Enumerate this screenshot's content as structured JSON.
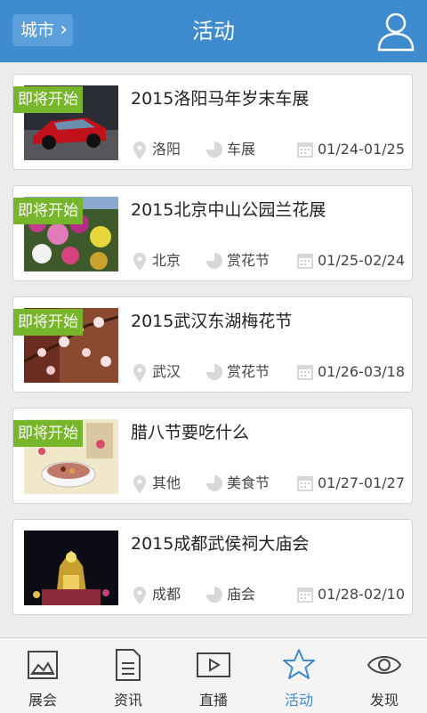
{
  "header": {
    "city_label": "城市",
    "title": "活动"
  },
  "events": [
    {
      "badge": "即将开始",
      "title": "2015洛阳马年岁末车展",
      "city": "洛阳",
      "category": "车展",
      "dates": "01/24-01/25"
    },
    {
      "badge": "即将开始",
      "title": "2015北京中山公园兰花展",
      "city": "北京",
      "category": "赏花节",
      "dates": "01/25-02/24"
    },
    {
      "badge": "即将开始",
      "title": "2015武汉东湖梅花节",
      "city": "武汉",
      "category": "赏花节",
      "dates": "01/26-03/18"
    },
    {
      "badge": "即将开始",
      "title": "腊八节要吃什么",
      "city": "其他",
      "category": "美食节",
      "dates": "01/27-01/27"
    },
    {
      "badge": "",
      "title": "2015成都武侯祠大庙会",
      "city": "成都",
      "category": "庙会",
      "dates": "01/28-02/10"
    }
  ],
  "tabs": [
    {
      "label": "展会",
      "icon": "picture-icon"
    },
    {
      "label": "资讯",
      "icon": "document-icon"
    },
    {
      "label": "直播",
      "icon": "play-icon"
    },
    {
      "label": "活动",
      "icon": "star-icon",
      "active": true
    },
    {
      "label": "发现",
      "icon": "eye-icon"
    }
  ],
  "colors": {
    "header": "#3f8bd0",
    "badge": "#77b62b",
    "active_tab": "#3f8bd0"
  }
}
